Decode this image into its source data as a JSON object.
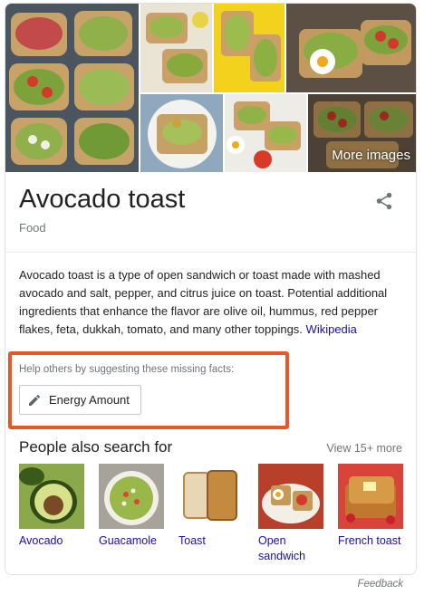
{
  "gallery": {
    "more_images_label": "More images"
  },
  "entity": {
    "title": "Avocado toast",
    "subtitle": "Food",
    "description": "Avocado toast is a type of open sandwich or toast made with mashed avocado and salt, pepper, and citrus juice on toast. Potential additional ingredients that enhance the flavor are olive oil, hummus, red pepper flakes, feta, dukkah, tomato, and many other toppings.",
    "source_link": "Wikipedia"
  },
  "missing_facts": {
    "help_text": "Help others by suggesting these missing facts:",
    "button_label": "Energy Amount"
  },
  "people_also_search": {
    "title": "People also search for",
    "view_more": "View 15+ more",
    "items": [
      {
        "label": "Avocado"
      },
      {
        "label": "Guacamole"
      },
      {
        "label": "Toast"
      },
      {
        "label": "Open sandwich"
      },
      {
        "label": "French toast"
      }
    ]
  },
  "footer": {
    "feedback": "Feedback"
  },
  "colors": {
    "link": "#1a0dab",
    "highlight_border": "#e8572a",
    "muted_text": "#70757a"
  }
}
